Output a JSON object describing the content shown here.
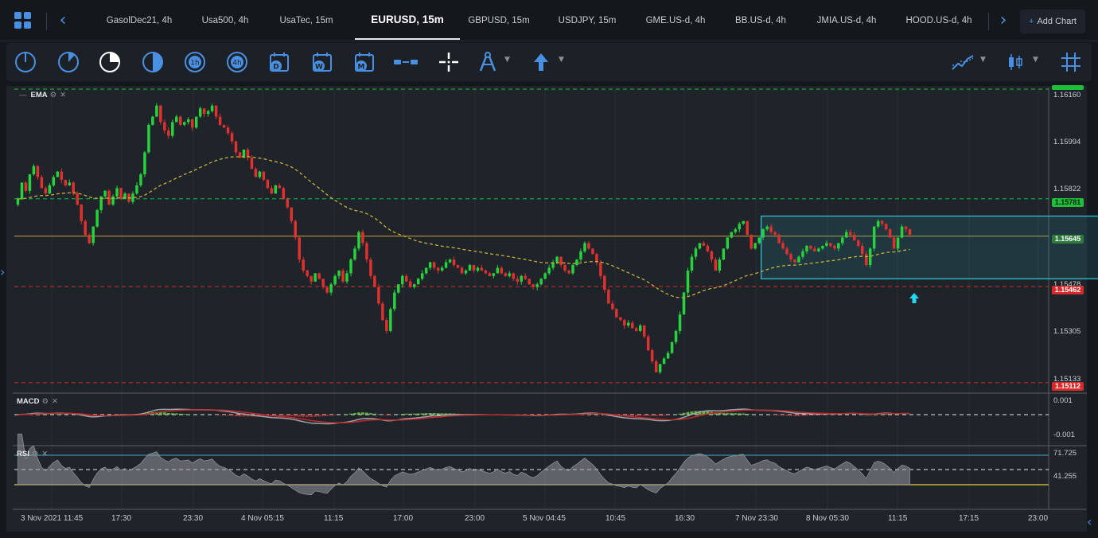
{
  "tabs": [
    {
      "label": "GasolDec21, 4h",
      "active": false
    },
    {
      "label": "Usa500, 4h",
      "active": false
    },
    {
      "label": "UsaTec, 15m",
      "active": false
    },
    {
      "label": "EURUSD, 15m",
      "active": true
    },
    {
      "label": "GBPUSD, 15m",
      "active": false
    },
    {
      "label": "USDJPY, 15m",
      "active": false
    },
    {
      "label": "GME.US-d, 4h",
      "active": false
    },
    {
      "label": "BB.US-d, 4h",
      "active": false
    },
    {
      "label": "JMIA.US-d, 4h",
      "active": false
    },
    {
      "label": "HOOD.US-d, 4h",
      "active": false
    }
  ],
  "add_chart_label": "Add Chart",
  "toolbar": {
    "tools": [
      {
        "icon": "clock-1m-icon"
      },
      {
        "icon": "clock-5m-icon"
      },
      {
        "icon": "clock-15m-icon",
        "active": true
      },
      {
        "icon": "clock-30m-icon"
      },
      {
        "icon": "clock-1h-icon",
        "text": "1h"
      },
      {
        "icon": "clock-4h-icon",
        "text": "4h"
      },
      {
        "icon": "calendar-day-icon",
        "text": "D"
      },
      {
        "icon": "calendar-week-icon",
        "text": "W"
      },
      {
        "icon": "calendar-month-icon",
        "text": "M"
      },
      {
        "icon": "horizontal-line-tool-icon"
      },
      {
        "icon": "crosshair-icon"
      },
      {
        "icon": "drawing-compass-icon"
      },
      {
        "icon": "arrow-up-icon"
      },
      {
        "icon": "indicators-icon"
      },
      {
        "icon": "candlestick-type-icon"
      },
      {
        "icon": "grid-icon"
      }
    ]
  },
  "indicators": {
    "main": "EMA",
    "macd": "MACD",
    "rsi": "RSI"
  },
  "price_axis": {
    "labels": [
      "1.16160",
      "1.15994",
      "1.15822",
      "1.15478",
      "1.15305",
      "1.15133"
    ],
    "badges": [
      {
        "value": "1.15781",
        "color": "#1fbf3a"
      },
      {
        "value": "1.15645",
        "color": "#2f7a3d"
      },
      {
        "value": "1.15462",
        "color": "#d62a2a"
      },
      {
        "value": "1.15112",
        "color": "#d62a2a"
      }
    ]
  },
  "macd_axis": [
    "0.001",
    "-0.001"
  ],
  "rsi_axis": [
    "71.725",
    "41.255"
  ],
  "time_axis": [
    "3 Nov 2021 11:45",
    "17:30",
    "23:30",
    "4 Nov 05:15",
    "11:15",
    "17:00",
    "23:00",
    "5 Nov 04:45",
    "10:45",
    "16:30",
    "7 Nov 23:30",
    "8 Nov 05:30",
    "11:15",
    "17:15",
    "23:00"
  ],
  "chart_data": {
    "type": "candlestick",
    "symbol": "EURUSD",
    "timeframe": "15m",
    "ylim": [
      1.151,
      1.1618
    ],
    "horizontal_lines": [
      {
        "value": 1.1618,
        "color": "#1fbf3a",
        "style": "dashed"
      },
      {
        "value": 1.15781,
        "color": "#1fbf3a",
        "style": "dashed"
      },
      {
        "value": 1.15645,
        "color": "#c8a23a",
        "style": "solid"
      },
      {
        "value": 1.15462,
        "color": "#d62a2a",
        "style": "dashed"
      },
      {
        "value": 1.15112,
        "color": "#d62a2a",
        "style": "dashed"
      }
    ],
    "rectangle": {
      "x_start_index": 188,
      "x_end_index": 260,
      "y_top": 1.15718,
      "y_bottom": 1.1549
    },
    "close_series": [
      1.1578,
      1.1584,
      1.1581,
      1.1587,
      1.159,
      1.1586,
      1.1582,
      1.158,
      1.1583,
      1.1586,
      1.1588,
      1.1585,
      1.1583,
      1.1584,
      1.158,
      1.1576,
      1.157,
      1.1565,
      1.1562,
      1.1568,
      1.1574,
      1.1579,
      1.1581,
      1.1576,
      1.1579,
      1.1582,
      1.1578,
      1.158,
      1.1577,
      1.158,
      1.1583,
      1.1587,
      1.1595,
      1.1605,
      1.1608,
      1.1612,
      1.1606,
      1.1603,
      1.1601,
      1.1606,
      1.1608,
      1.1605,
      1.1606,
      1.1607,
      1.1604,
      1.1608,
      1.1611,
      1.1609,
      1.161,
      1.1612,
      1.1608,
      1.1605,
      1.1604,
      1.1602,
      1.1599,
      1.1595,
      1.1593,
      1.1596,
      1.1593,
      1.1589,
      1.1586,
      1.1588,
      1.1585,
      1.1582,
      1.158,
      1.1583,
      1.1582,
      1.1578,
      1.1575,
      1.157,
      1.1564,
      1.1556,
      1.1552,
      1.155,
      1.1548,
      1.1551,
      1.1549,
      1.1546,
      1.1544,
      1.1547,
      1.155,
      1.1552,
      1.1548,
      1.1551,
      1.1556,
      1.156,
      1.1566,
      1.1562,
      1.1556,
      1.155,
      1.1546,
      1.154,
      1.1534,
      1.153,
      1.1538,
      1.1544,
      1.1547,
      1.155,
      1.1548,
      1.1546,
      1.1547,
      1.1549,
      1.1551,
      1.1553,
      1.1555,
      1.1553,
      1.1552,
      1.1553,
      1.1555,
      1.1556,
      1.1554,
      1.1553,
      1.1551,
      1.1552,
      1.1554,
      1.1552,
      1.1553,
      1.1552,
      1.1551,
      1.155,
      1.1551,
      1.1553,
      1.1551,
      1.155,
      1.1551,
      1.1549,
      1.1548,
      1.155,
      1.1549,
      1.1547,
      1.1546,
      1.1547,
      1.1549,
      1.1551,
      1.1553,
      1.1555,
      1.1557,
      1.1554,
      1.1552,
      1.1551,
      1.1554,
      1.1556,
      1.1559,
      1.1562,
      1.156,
      1.1558,
      1.1555,
      1.155,
      1.1545,
      1.154,
      1.1538,
      1.1535,
      1.1534,
      1.1532,
      1.1533,
      1.1531,
      1.153,
      1.1532,
      1.1528,
      1.1523,
      1.1519,
      1.1515,
      1.1518,
      1.152,
      1.1522,
      1.1526,
      1.153,
      1.1536,
      1.1544,
      1.1552,
      1.1557,
      1.156,
      1.1562,
      1.1561,
      1.1559,
      1.1556,
      1.1552,
      1.1556,
      1.156,
      1.1564,
      1.1566,
      1.1567,
      1.1569,
      1.157,
      1.1565,
      1.156,
      1.1562,
      1.1564,
      1.1567,
      1.1568,
      1.1566,
      1.1565,
      1.1562,
      1.156,
      1.1558,
      1.1556,
      1.1555,
      1.1557,
      1.1559,
      1.1561,
      1.156,
      1.1559,
      1.156,
      1.1561,
      1.1562,
      1.1561,
      1.156,
      1.1562,
      1.1564,
      1.1566,
      1.1565,
      1.1563,
      1.1561,
      1.1558,
      1.1554,
      1.156,
      1.1568,
      1.157,
      1.1569,
      1.1567,
      1.1564,
      1.156,
      1.1564,
      1.1568,
      1.1567,
      1.1565
    ]
  }
}
